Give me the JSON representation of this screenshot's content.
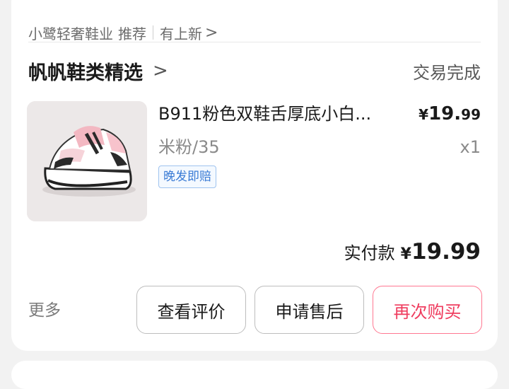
{
  "header": {
    "store_line": "小鹭轻奢鞋业",
    "recommend": "推荐",
    "new_arrivals": "有上新",
    "chevron": ">"
  },
  "shop": {
    "name": "帆帆鞋类精选",
    "chevron": ">",
    "status": "交易完成"
  },
  "product": {
    "title": "B911粉色双鞋舌厚底小白...",
    "price_currency": "¥",
    "price_int": "19.",
    "price_dec": "99",
    "variant": "米粉/35",
    "quantity": "x1",
    "badge": "晚发即赔",
    "thumb_icon": "sneaker-image"
  },
  "total": {
    "label": "实付款",
    "currency": "¥",
    "amount": "19.99"
  },
  "actions": {
    "more": "更多",
    "review": "查看评价",
    "after_sales": "申请售后",
    "rebuy": "再次购买"
  },
  "colors": {
    "accent": "#ef3c5e",
    "badge_blue": "#3a7bd5"
  }
}
